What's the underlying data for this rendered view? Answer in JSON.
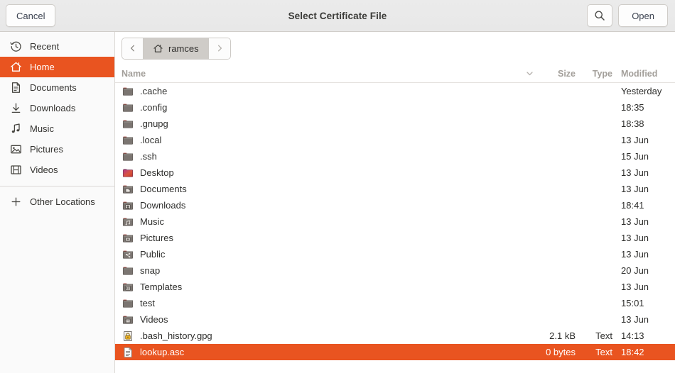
{
  "header": {
    "title": "Select Certificate File",
    "cancel_label": "Cancel",
    "open_label": "Open",
    "search_icon": "search-icon"
  },
  "sidebar": {
    "items": [
      {
        "label": "Recent",
        "icon": "clock-icon",
        "selected": false
      },
      {
        "label": "Home",
        "icon": "home-icon",
        "selected": true
      },
      {
        "label": "Documents",
        "icon": "document-icon",
        "selected": false
      },
      {
        "label": "Downloads",
        "icon": "download-icon",
        "selected": false
      },
      {
        "label": "Music",
        "icon": "music-icon",
        "selected": false
      },
      {
        "label": "Pictures",
        "icon": "picture-icon",
        "selected": false
      },
      {
        "label": "Videos",
        "icon": "video-icon",
        "selected": false
      }
    ],
    "other_locations": {
      "label": "Other Locations",
      "icon": "plus-icon"
    }
  },
  "pathbar": {
    "back_icon": "chevron-left-icon",
    "forward_icon": "chevron-right-icon",
    "current": {
      "label": "ramces",
      "icon": "home-icon"
    }
  },
  "columns": {
    "name": "Name",
    "sort_icon": "chevron-down-icon",
    "size": "Size",
    "type": "Type",
    "modified": "Modified"
  },
  "files": [
    {
      "name": ".cache",
      "icon": "folder-icon",
      "size": "",
      "type": "",
      "modified": "Yesterday",
      "selected": false
    },
    {
      "name": ".config",
      "icon": "folder-icon",
      "size": "",
      "type": "",
      "modified": "18:35",
      "selected": false
    },
    {
      "name": ".gnupg",
      "icon": "folder-icon",
      "size": "",
      "type": "",
      "modified": "18:38",
      "selected": false
    },
    {
      "name": ".local",
      "icon": "folder-icon",
      "size": "",
      "type": "",
      "modified": "13 Jun",
      "selected": false
    },
    {
      "name": ".ssh",
      "icon": "folder-icon",
      "size": "",
      "type": "",
      "modified": "15 Jun",
      "selected": false
    },
    {
      "name": "Desktop",
      "icon": "desktop-folder-icon",
      "size": "",
      "type": "",
      "modified": "13 Jun",
      "selected": false
    },
    {
      "name": "Documents",
      "icon": "documents-folder-icon",
      "size": "",
      "type": "",
      "modified": "13 Jun",
      "selected": false
    },
    {
      "name": "Downloads",
      "icon": "downloads-folder-icon",
      "size": "",
      "type": "",
      "modified": "18:41",
      "selected": false
    },
    {
      "name": "Music",
      "icon": "music-folder-icon",
      "size": "",
      "type": "",
      "modified": "13 Jun",
      "selected": false
    },
    {
      "name": "Pictures",
      "icon": "pictures-folder-icon",
      "size": "",
      "type": "",
      "modified": "13 Jun",
      "selected": false
    },
    {
      "name": "Public",
      "icon": "public-folder-icon",
      "size": "",
      "type": "",
      "modified": "13 Jun",
      "selected": false
    },
    {
      "name": "snap",
      "icon": "folder-icon",
      "size": "",
      "type": "",
      "modified": "20 Jun",
      "selected": false
    },
    {
      "name": "Templates",
      "icon": "templates-folder-icon",
      "size": "",
      "type": "",
      "modified": "13 Jun",
      "selected": false
    },
    {
      "name": "test",
      "icon": "folder-icon",
      "size": "",
      "type": "",
      "modified": "15:01",
      "selected": false
    },
    {
      "name": "Videos",
      "icon": "videos-folder-icon",
      "size": "",
      "type": "",
      "modified": "13 Jun",
      "selected": false
    },
    {
      "name": ".bash_history.gpg",
      "icon": "lock-file-icon",
      "size": "2.1 kB",
      "type": "Text",
      "modified": "14:13",
      "selected": false
    },
    {
      "name": "lookup.asc",
      "icon": "text-file-icon",
      "size": "0 bytes",
      "type": "Text",
      "modified": "18:42",
      "selected": true
    }
  ],
  "colors": {
    "accent": "#e95420",
    "header_bg": "#ebebeb",
    "sidebar_bg": "#fafafa",
    "folder_body": "#77716c",
    "folder_tab": "#a3453c"
  }
}
